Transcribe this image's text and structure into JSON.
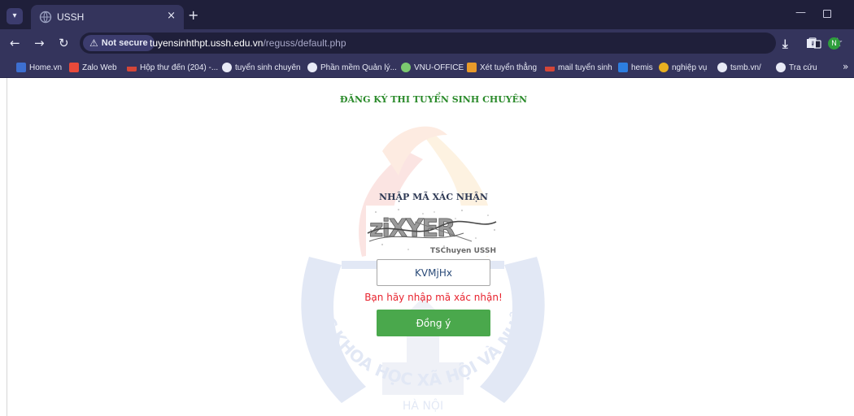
{
  "browser": {
    "tab_title": "USSH",
    "tab_close": "×",
    "new_tab": "+",
    "security_label": "Not secure",
    "url_host": "tuyensinhthpt.ussh.edu.vn",
    "url_path": "/reguss/default.php",
    "profile_initial": "N",
    "icons": [
      "tab-menu-icon",
      "back-icon",
      "forward-icon",
      "reload-icon",
      "warning-icon",
      "translate-icon",
      "star-icon",
      "download-icon",
      "side-panel-icon",
      "minimize-icon",
      "maximize-icon"
    ]
  },
  "bookmarks": [
    {
      "label": "Home.vn",
      "icon": "home-vn-icon",
      "color": "#3d6fd0"
    },
    {
      "label": "Zalo Web",
      "icon": "zalo-icon",
      "color": "#e84a3a"
    },
    {
      "label": "Hộp thư đến (204) -...",
      "icon": "gmail-icon",
      "color": "#d44638"
    },
    {
      "label": "tuyển sinh chuyên",
      "icon": "globe-icon",
      "color": "#e8eaf6"
    },
    {
      "label": "Phần mềm Quản lý...",
      "icon": "globe-icon",
      "color": "#e8eaf6"
    },
    {
      "label": "VNU-OFFICE",
      "icon": "office-icon",
      "color": "#7bc96f"
    },
    {
      "label": "Xét tuyển thẳng",
      "icon": "folder-icon",
      "color": "#e89a2a"
    },
    {
      "label": "mail tuyển sinh",
      "icon": "gmail-icon",
      "color": "#d44638"
    },
    {
      "label": "hemis",
      "icon": "hemis-icon",
      "color": "#2d7ee0"
    },
    {
      "label": "nghiệp vụ",
      "icon": "emblem-icon",
      "color": "#e8b020"
    },
    {
      "label": "tsmb.vn/",
      "icon": "globe-icon",
      "color": "#e8eaf6"
    },
    {
      "label": "Tra cứu",
      "icon": "globe-icon",
      "color": "#e8eaf6"
    }
  ],
  "bookmarks_more": "»",
  "page": {
    "title": "ĐĂNG KÝ THI TUYỂN SINH CHUYÊN",
    "captcha_heading": "NHẬP MÃ XÁC NHẬN",
    "captcha_text": "ziXYER",
    "captcha_caption": "TSChuyen USSH",
    "input_value": "KVMjHx",
    "error_message": "Bạn hãy nhập mã xác nhận!",
    "submit_label": "Đồng ý",
    "watermark_arc_text": "ĐẠI HỌC KHOA HỌC XÃ HỘI VÀ NHÂN VĂN",
    "watermark_city": "HÀ NỘI"
  },
  "colors": {
    "title_green": "#2a8a2a",
    "error_red": "#e8232e",
    "button_green": "#4aa84c",
    "chrome_dark": "#1f1f3a",
    "chrome_mid": "#34345c"
  }
}
